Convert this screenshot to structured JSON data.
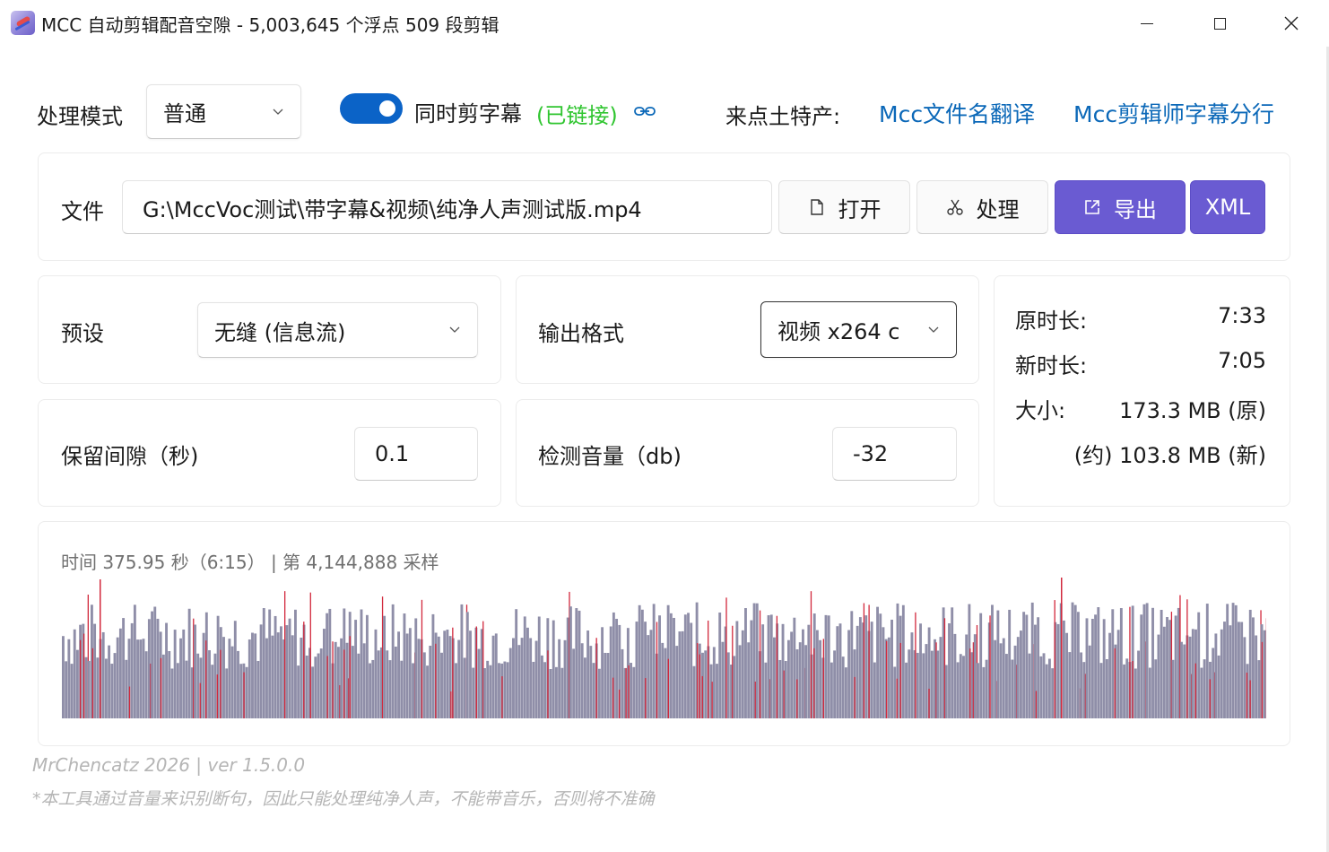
{
  "window": {
    "title": "MCC 自动剪辑配音空隙 - 5,003,645 个浮点 509 段剪辑"
  },
  "top": {
    "mode_label": "处理模式",
    "mode_value": "普通",
    "subtitle_toggle_on": true,
    "subtitle_label": "同时剪字幕",
    "linked_label": "(已链接)",
    "promo_label": "来点土特产:",
    "link1": "Mcc文件名翻译",
    "link2": "Mcc剪辑师字幕分行"
  },
  "file": {
    "label": "文件",
    "path": "G:\\MccVoc测试\\带字幕&视频\\纯净人声测试版.mp4",
    "open_button": "打开",
    "process_button": "处理",
    "export_button": "导出",
    "xml_button": "XML"
  },
  "settings": {
    "preset_label": "预设",
    "preset_value": "无缝 (信息流)",
    "format_label": "输出格式",
    "format_value": "视频 x264 c",
    "gap_label": "保留间隙（秒)",
    "gap_value": "0.1",
    "volume_label": "检测音量（db)",
    "volume_value": "-32"
  },
  "stats": {
    "orig_label": "原时长:",
    "orig_value": "7:33",
    "new_label": "新时长:",
    "new_value": "7:05",
    "size_label": "大小:",
    "size_orig": "173.3 MB (原)",
    "size_new": "(约) 103.8 MB (新)"
  },
  "waveform": {
    "caption": "时间 375.95 秒（6:15） | 第 4,144,888 采样",
    "bar_color": "#8f8ea8",
    "cut_color": "#d2283c",
    "bar_count": 420,
    "seed": 7
  },
  "footer": {
    "credit": "MrChencatz 2026  |  ver 1.5.0.0",
    "note": "*本工具通过音量来识别断句，因此只能处理纯净人声，不能带音乐，否则将不准确"
  },
  "colors": {
    "accent": "#6a5bd2",
    "toggle": "#0b63c7",
    "link": "#0b68b8",
    "linked": "#2fc52f"
  }
}
